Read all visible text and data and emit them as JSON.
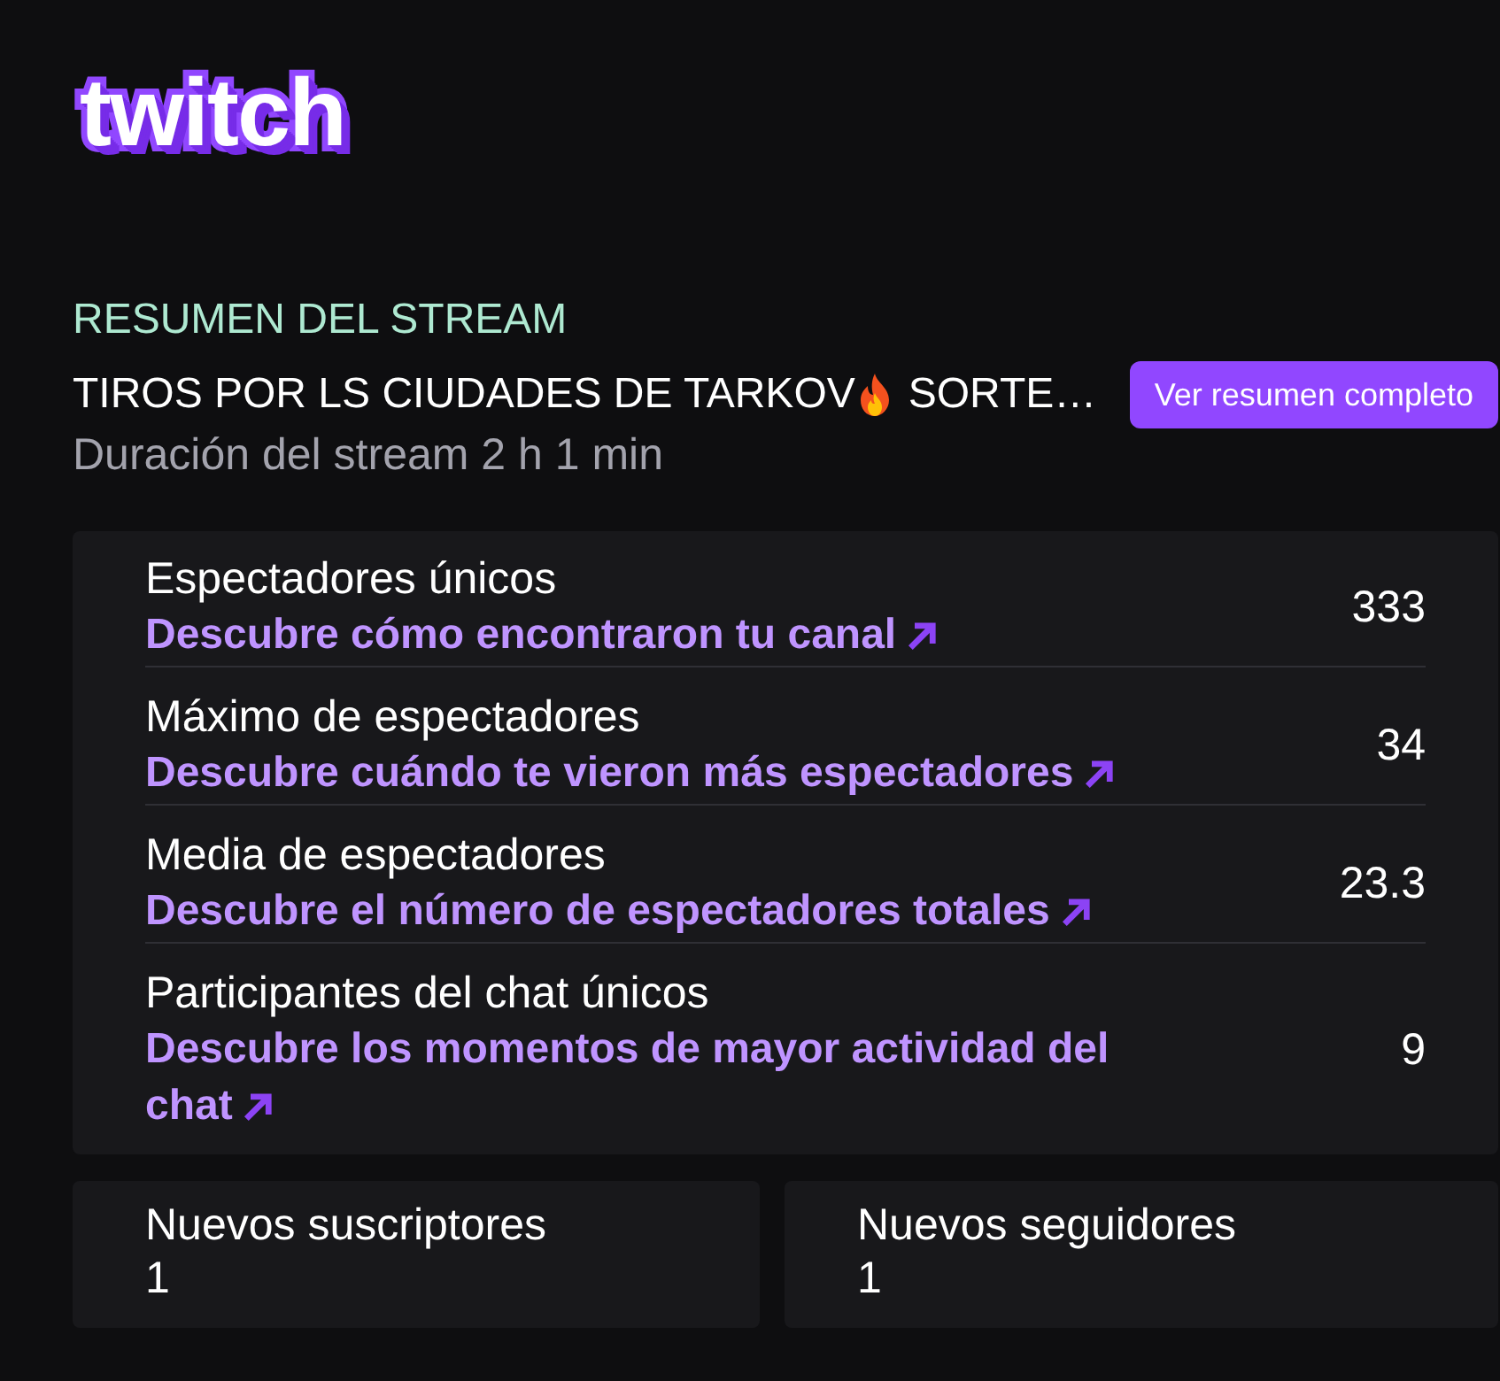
{
  "logo": {
    "text": "twitch"
  },
  "summary": {
    "heading": "RESUMEN DEL STREAM",
    "title_parts": [
      "TIROS POR LS CIUDADES DE TARKOV",
      "SORTE…"
    ],
    "duration": "Duración del stream 2 h 1 min",
    "button": "Ver resumen completo"
  },
  "stats": [
    {
      "label": "Espectadores únicos",
      "link": "Descubre cómo encontraron tu canal",
      "value": "333"
    },
    {
      "label": "Máximo de espectadores",
      "link": "Descubre cuándo te vieron más espectadores",
      "value": "34"
    },
    {
      "label": "Media de espectadores",
      "link": "Descubre el número de espectadores totales",
      "value": "23.3"
    },
    {
      "label": "Participantes del chat únicos",
      "link": "Descubre los momentos de mayor actividad del chat",
      "value": "9"
    }
  ],
  "totals": [
    {
      "label": "Nuevos suscriptores",
      "value": "1"
    },
    {
      "label": "Nuevos seguidores",
      "value": "1"
    }
  ]
}
